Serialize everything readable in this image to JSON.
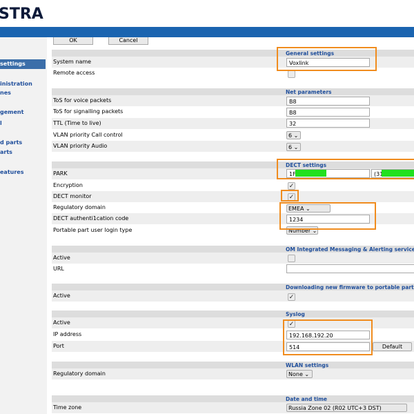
{
  "header": {
    "logo": "STRA"
  },
  "top_buttons": {
    "ok": "OK",
    "cancel": "Cancel"
  },
  "sidebar": {
    "items": [
      {
        "label": "settings",
        "active": true
      },
      {
        "label": "inistration"
      },
      {
        "label": "nes"
      },
      {
        "label": "gement"
      },
      {
        "label": "l"
      },
      {
        "label": "d parts"
      },
      {
        "label": "arts"
      },
      {
        "label": "eatures"
      }
    ]
  },
  "sections": {
    "general": "General settings",
    "net": "Net parameters",
    "dect": "DECT settings",
    "om": "OM Integrated Messaging & Alerting service",
    "firmware": "Downloading new firmware to portable parts",
    "syslog": "Syslog",
    "wlan": "WLAN settings",
    "datetime": "Date and time"
  },
  "general": {
    "system_name_label": "System name",
    "system_name_value": "Voxlink",
    "remote_access_label": "Remote access",
    "remote_access_checked": false
  },
  "net": {
    "tos_voice_label": "ToS for voice packets",
    "tos_voice_value": "B8",
    "tos_signal_label": "ToS for signalling packets",
    "tos_signal_value": "B8",
    "ttl_label": "TTL (Time to live)",
    "ttl_value": "32",
    "vlan_call_label": "VLAN priority Call control",
    "vlan_call_value": "6 ⌄",
    "vlan_audio_label": "VLAN priority Audio",
    "vlan_audio_value": "6 ⌄"
  },
  "dect": {
    "park_label": "PARK",
    "park_value": "1F",
    "park_value2": "(31",
    "encryption_label": "Encryption",
    "encryption_checked": true,
    "monitor_label": "DECT monitor",
    "monitor_checked": true,
    "reg_domain_label": "Regulatory domain",
    "reg_domain_value": "EMEA ⌄",
    "auth_label": "DECT authenti1cation code",
    "auth_value": "1234",
    "login_type_label": "Portable part user login type",
    "login_type_value": "Number ⌄"
  },
  "om": {
    "active_label": "Active",
    "active_checked": false,
    "url_label": "URL",
    "url_value": ""
  },
  "firmware": {
    "active_label": "Active",
    "active_checked": true
  },
  "syslog": {
    "active_label": "Active",
    "active_checked": true,
    "ip_label": "IP address",
    "ip_value": "192.168.192.20",
    "port_label": "Port",
    "port_value": "514",
    "default_button": "Default"
  },
  "wlan": {
    "reg_domain_label": "Regulatory domain",
    "reg_domain_value": "None ⌄"
  },
  "datetime": {
    "timezone_label": "Time zone",
    "timezone_value": "Russia Zone 02 (R02 UTC+3 DST)"
  },
  "colors": {
    "brand_blue": "#1a64b0",
    "highlight_orange": "#f08c1e",
    "redaction_green": "#22e01f",
    "link_blue": "#1f4e9b"
  }
}
